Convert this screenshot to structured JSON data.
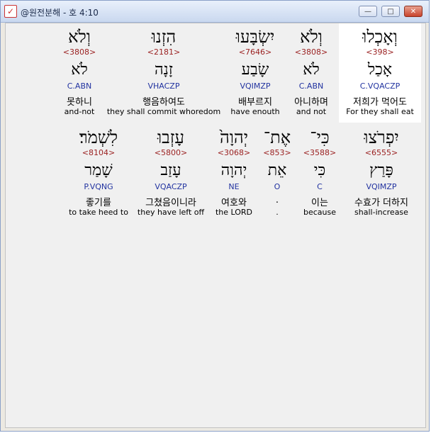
{
  "window": {
    "title": "@원전분해 - 호 4:10",
    "buttons": {
      "minimize": "—",
      "maximize": "□",
      "close": "✕"
    },
    "icon": "app-checkmark-icon"
  },
  "rows": [
    {
      "words": [
        {
          "hebrew": "וְלֹא",
          "strong": "<3808>",
          "lemma": "לֹא",
          "morph": "C.ABN",
          "korean": "못하니",
          "english": "and-not",
          "selected": false
        },
        {
          "hebrew": "הִזְנוּ",
          "strong": "<2181>",
          "lemma": "זָנָה",
          "morph": "VHACZP",
          "korean": "행음하여도",
          "english": "they shall commit whoredom",
          "selected": false
        },
        {
          "hebrew": "יִשְׂבָּעוּ",
          "strong": "<7646>",
          "lemma": "שָׂבַע",
          "morph": "VQIMZP",
          "korean": "배부르지",
          "english": "have enouth",
          "selected": false
        },
        {
          "hebrew": "וְלֹא",
          "strong": "<3808>",
          "lemma": "לֹא",
          "morph": "C.ABN",
          "korean": "아니하며",
          "english": "and not",
          "selected": false
        },
        {
          "hebrew": "וְאָכְלוּ",
          "strong": "<398>",
          "lemma": "אָכַל",
          "morph": "C.VQACZP",
          "korean": "저희가 먹어도",
          "english": "For they shall eat",
          "selected": true
        }
      ]
    },
    {
      "words": [
        {
          "hebrew": "לִשְׁמֹר׃",
          "strong": "<8104>",
          "lemma": "שָׁמַר",
          "morph": "P.VQNG",
          "korean": "좋기를",
          "english": "to take heed to",
          "selected": false
        },
        {
          "hebrew": "עָזְבוּ",
          "strong": "<5800>",
          "lemma": "עָזַב",
          "morph": "VQACZP",
          "korean": "그쳤음이니라",
          "english": "they have left off",
          "selected": false
        },
        {
          "hebrew": "יְהוָה֙",
          "strong": "<3068>",
          "lemma": "יְהוָה",
          "morph": "NE",
          "korean": "여호와",
          "english": "the LORD",
          "selected": false
        },
        {
          "hebrew": "אֶת־",
          "strong": "<853>",
          "lemma": "אֵת",
          "morph": "O",
          "korean": ".",
          "english": ".",
          "selected": false
        },
        {
          "hebrew": "כִּי־",
          "strong": "<3588>",
          "lemma": "כִּי",
          "morph": "C",
          "korean": "이는",
          "english": "because",
          "selected": false
        },
        {
          "hebrew": "יִפְרֹצוּ",
          "strong": "<6555>",
          "lemma": "פָּרַץ",
          "morph": "VQIMZP",
          "korean": "수효가 더하지",
          "english": "shall-increase",
          "selected": false
        }
      ]
    }
  ]
}
